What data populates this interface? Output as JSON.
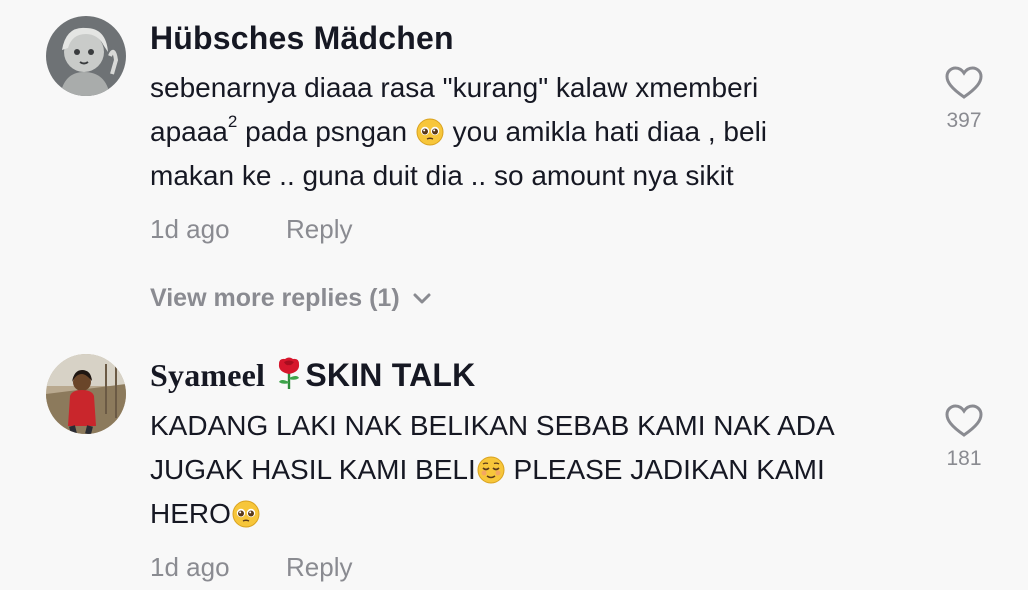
{
  "comments": [
    {
      "username": "Hübsches Mädchen",
      "text": {
        "line1": "sebenarnya diaaa rasa \"kurang\" kalaw xmemberi",
        "line2a": "apaaa",
        "line2sup": "2",
        "line2b": " pada psngan ",
        "line2c": "  you amikla hati diaa , beli",
        "line3": "makan ke .. guna duit dia .. so amount nya sikit"
      },
      "time": "1d ago",
      "reply_label": "Reply",
      "likes": "397",
      "view_more": "View more replies (1)"
    },
    {
      "username_part1": "Syameel ",
      "username_part2": "SKIN TALK",
      "text": {
        "line1": "KADANG LAKI NAK BELIKAN SEBAB KAMI NAK ADA",
        "line2a": "JUGAK HASIL KAMI BELI",
        "line2b": " PLEASE JADIKAN KAMI",
        "line3": "HERO"
      },
      "time": "1d ago",
      "reply_label": "Reply",
      "likes": "181"
    }
  ],
  "icons": {
    "like": "heart-outline-icon",
    "pleading": "pleading-face-emoji",
    "relieved": "relieved-face-emoji",
    "rose": "rose-emoji",
    "chevron": "chevron-down-icon"
  },
  "colors": {
    "background": "#f8f8f8",
    "text": "#161823",
    "muted": "#8a8b91"
  }
}
